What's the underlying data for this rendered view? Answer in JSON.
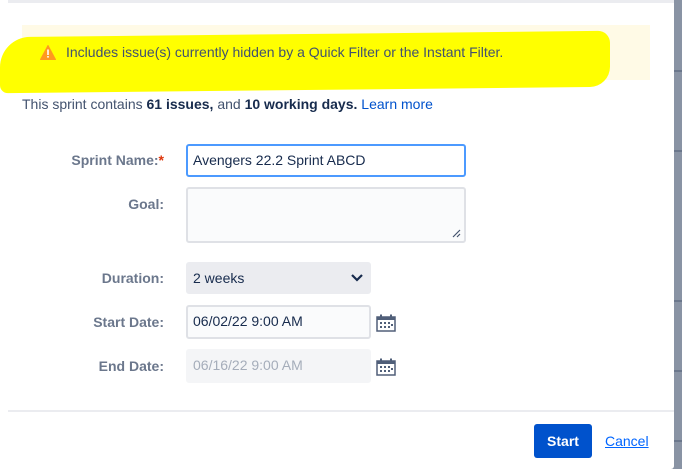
{
  "warning": {
    "icon": "warning-icon",
    "text": "Includes issue(s) currently hidden by a Quick Filter or the Instant Filter."
  },
  "info": {
    "prefix": "This sprint contains ",
    "issues": "61 issues,",
    "middle": " and ",
    "days": "10 working days.",
    "link": "Learn more"
  },
  "form": {
    "sprint_name_label": "Sprint Name:",
    "required_mark": "*",
    "sprint_name_value": "Avengers 22.2 Sprint ABCD",
    "goal_label": "Goal:",
    "goal_value": "",
    "duration_label": "Duration:",
    "duration_value": "2 weeks",
    "start_date_label": "Start Date:",
    "start_date_value": "06/02/22 9:00 AM",
    "end_date_label": "End Date:",
    "end_date_value": "06/16/22 9:00 AM"
  },
  "footer": {
    "start": "Start",
    "cancel": "Cancel"
  },
  "colors": {
    "primary": "#0052cc",
    "link": "#0065ff",
    "warning_bg": "#fffae6",
    "highlight": "#ffff00"
  }
}
